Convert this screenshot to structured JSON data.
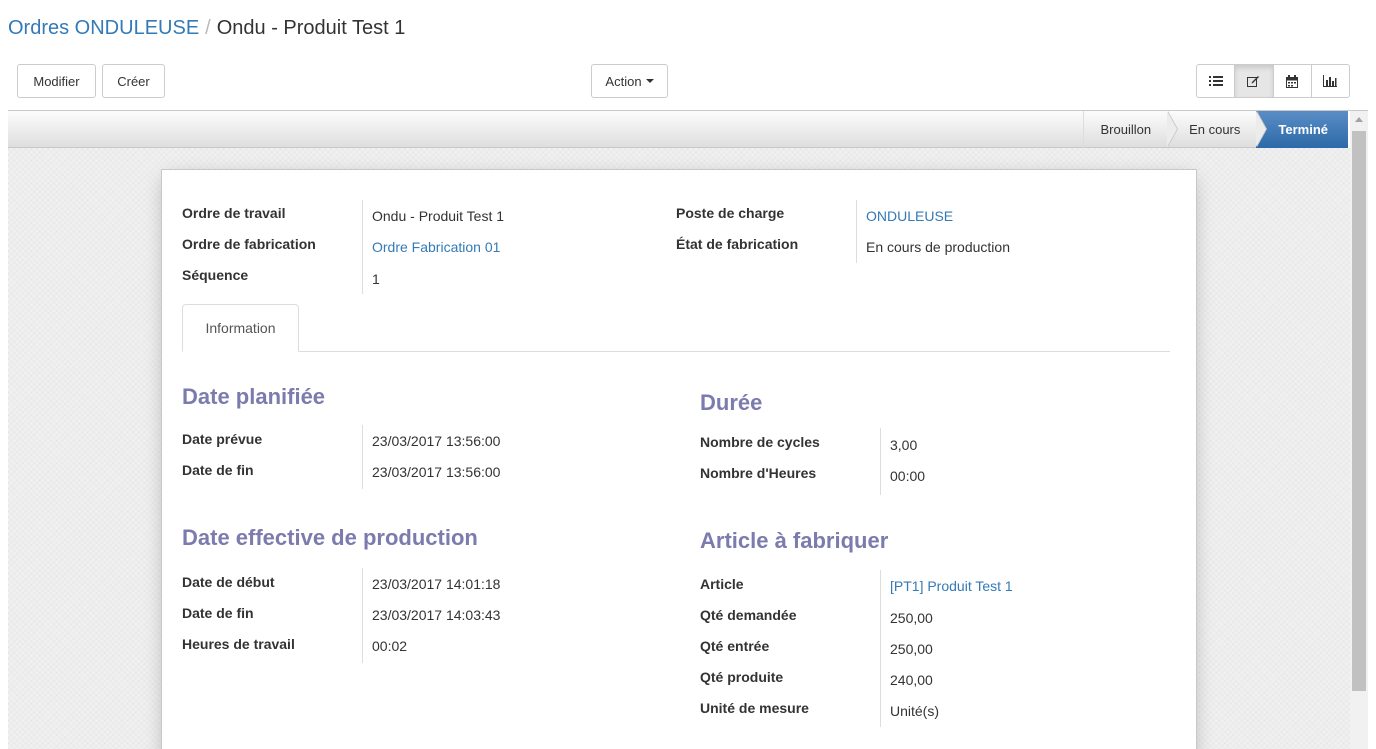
{
  "breadcrumb": {
    "parent": "Ordres ONDULEUSE",
    "separator": "/",
    "current": "Ondu - Produit Test 1"
  },
  "buttons": {
    "modifier": "Modifier",
    "creer": "Créer",
    "action": "Action"
  },
  "views": [
    "list-icon",
    "form-icon",
    "calendar-icon",
    "graph-icon"
  ],
  "stages": {
    "brouillon": "Brouillon",
    "en_cours": "En cours",
    "termine": "Terminé"
  },
  "header_fields": {
    "ordre_travail_label": "Ordre de travail",
    "ordre_travail_value": "Ondu - Produit Test 1",
    "ordre_fabrication_label": "Ordre de fabrication",
    "ordre_fabrication_value": "Ordre Fabrication 01",
    "sequence_label": "Séquence",
    "sequence_value": "1",
    "poste_charge_label": "Poste de charge",
    "poste_charge_value": "ONDULEUSE",
    "etat_fabrication_label": "État de fabrication",
    "etat_fabrication_value": "En cours de production"
  },
  "tab": "Information",
  "date_planifiee": {
    "title": "Date planifiée",
    "date_prevue_label": "Date prévue",
    "date_prevue_value": "23/03/2017 13:56:00",
    "date_fin_label": "Date de fin",
    "date_fin_value": "23/03/2017 13:56:00"
  },
  "duree": {
    "title": "Durée",
    "nb_cycles_label": "Nombre de cycles",
    "nb_cycles_value": "3,00",
    "nb_heures_label": "Nombre d'Heures",
    "nb_heures_value": "00:00"
  },
  "date_effective": {
    "title": "Date effective de production",
    "date_debut_label": "Date de début",
    "date_debut_value": "23/03/2017 14:01:18",
    "date_fin_label": "Date de fin",
    "date_fin_value": "23/03/2017 14:03:43",
    "heures_travail_label": "Heures de travail",
    "heures_travail_value": "00:02"
  },
  "article": {
    "title": "Article à fabriquer",
    "article_label": "Article",
    "article_value": "[PT1] Produit Test 1",
    "qte_demandee_label": "Qté demandée",
    "qte_demandee_value": "250,00",
    "qte_entree_label": "Qté entrée",
    "qte_entree_value": "250,00",
    "qte_produite_label": "Qté produite",
    "qte_produite_value": "240,00",
    "unite_label": "Unité de mesure",
    "unite_value": "Unité(s)"
  }
}
